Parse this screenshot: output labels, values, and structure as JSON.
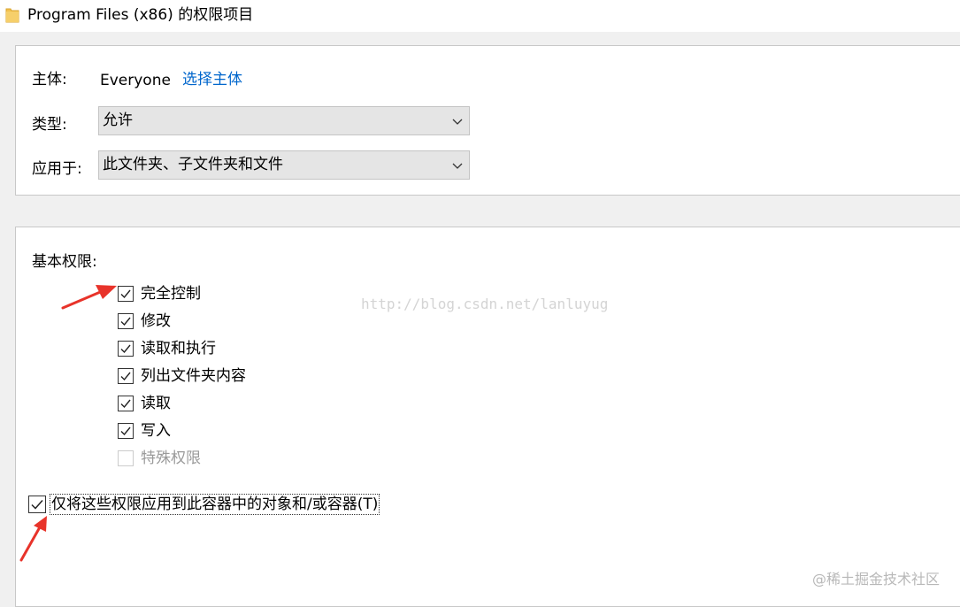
{
  "window": {
    "title": "Program Files (x86) 的权限项目",
    "icon": "folder-icon"
  },
  "principal": {
    "label": "主体:",
    "value": "Everyone",
    "select_link": "选择主体"
  },
  "type": {
    "label": "类型:",
    "selected": "允许"
  },
  "applies_to": {
    "label": "应用于:",
    "selected": "此文件夹、子文件夹和文件"
  },
  "basic_permissions": {
    "heading": "基本权限:",
    "items": [
      {
        "label": "完全控制",
        "checked": true,
        "enabled": true
      },
      {
        "label": "修改",
        "checked": true,
        "enabled": true
      },
      {
        "label": "读取和执行",
        "checked": true,
        "enabled": true
      },
      {
        "label": "列出文件夹内容",
        "checked": true,
        "enabled": true
      },
      {
        "label": "读取",
        "checked": true,
        "enabled": true
      },
      {
        "label": "写入",
        "checked": true,
        "enabled": true
      },
      {
        "label": "特殊权限",
        "checked": false,
        "enabled": false
      }
    ]
  },
  "apply_only": {
    "label": "仅将这些权限应用到此容器中的对象和/或容器(T)",
    "checked": true
  },
  "watermarks": {
    "url": "http://blog.csdn.net/lanluyug",
    "brand": "@稀土掘金技术社区"
  },
  "colors": {
    "link": "#0066cc",
    "annotation_arrow": "#e8332a",
    "folder": "#f2c14e"
  }
}
